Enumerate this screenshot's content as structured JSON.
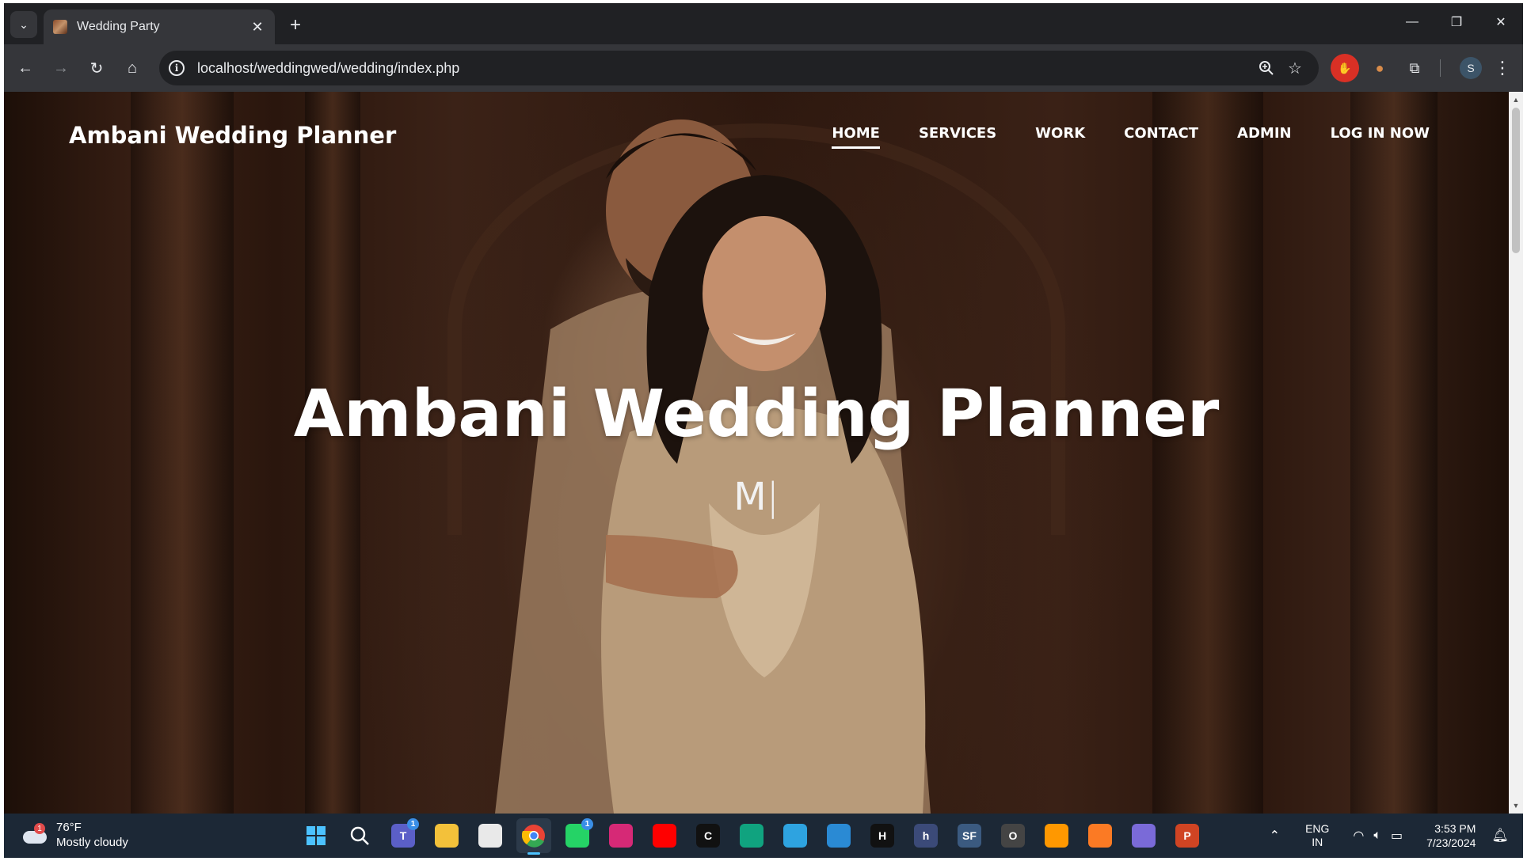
{
  "browser": {
    "tab": {
      "title": "Wedding Party"
    },
    "url": "localhost/weddingwed/wedding/index.php",
    "profile_initial": "S"
  },
  "site": {
    "brand": "Ambani Wedding Planner",
    "nav": [
      {
        "label": "HOME",
        "active": true
      },
      {
        "label": "SERVICES"
      },
      {
        "label": "WORK"
      },
      {
        "label": "CONTACT"
      },
      {
        "label": "ADMIN"
      },
      {
        "label": "LOG IN NOW"
      }
    ],
    "hero": {
      "title": "Ambani Wedding Planner",
      "typed_text": "M",
      "cursor": "|"
    }
  },
  "taskbar": {
    "weather": {
      "temp": "76°F",
      "condition": "Mostly cloudy",
      "badge": "1"
    },
    "apps": [
      {
        "name": "windows-start",
        "color": "#4cc2ff"
      },
      {
        "name": "search",
        "color": "#ffffff"
      },
      {
        "name": "teams",
        "color": "#5b5fc7",
        "badge": "1",
        "glyph": "T"
      },
      {
        "name": "file-explorer",
        "color": "#f3c13a"
      },
      {
        "name": "microsoft-store",
        "color": "#e9e9e9"
      },
      {
        "name": "chrome",
        "color": "#34a853",
        "active": true
      },
      {
        "name": "whatsapp",
        "color": "#25d366",
        "badge": "1"
      },
      {
        "name": "instagram",
        "color": "#d62976"
      },
      {
        "name": "youtube",
        "color": "#ff0000"
      },
      {
        "name": "capcut",
        "color": "#111111",
        "glyph": "C"
      },
      {
        "name": "chatgpt",
        "color": "#10a37f"
      },
      {
        "name": "edge",
        "color": "#2ea3e0"
      },
      {
        "name": "vscode",
        "color": "#2a8ad4"
      },
      {
        "name": "hackerrank",
        "color": "#111111",
        "glyph": "H"
      },
      {
        "name": "h-app",
        "color": "#3b4a78",
        "glyph": "h"
      },
      {
        "name": "sourceforge",
        "color": "#3b5a80",
        "glyph": "SF"
      },
      {
        "name": "o-app",
        "color": "#444444",
        "glyph": "O"
      },
      {
        "name": "sublime-text",
        "color": "#ff9800"
      },
      {
        "name": "xampp",
        "color": "#fb7a24"
      },
      {
        "name": "eclipse",
        "color": "#7a6ad8"
      },
      {
        "name": "powerpoint",
        "color": "#d04423",
        "glyph": "P"
      }
    ],
    "tray": {
      "language": "ENG",
      "region": "IN",
      "time": "3:53 PM",
      "date": "7/23/2024"
    }
  }
}
